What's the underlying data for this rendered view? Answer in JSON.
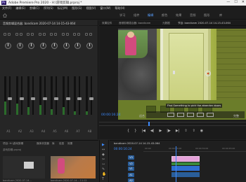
{
  "window": {
    "title": "Adobe Premiere Pro 2020 - H:\\游戏剪辑.prproj *",
    "app_icon": "Pr",
    "controls": [
      "—",
      "☐",
      "✕"
    ]
  },
  "menu": [
    "文件(F)",
    "编辑(E)",
    "剪辑(C)",
    "序列(S)",
    "标记(M)",
    "图形(G)",
    "视图(V)",
    "窗口(W)",
    "帮助(H)"
  ],
  "workspaces": [
    "学习",
    "组件",
    "编辑",
    "颜色",
    "效果",
    "音频",
    "图形",
    "库"
  ],
  "mixer": {
    "title": "音频剪辑混合器: bandicam 2020-07-14 14-15-43-064",
    "channels": [
      "A1",
      "A2",
      "A3",
      "A4",
      "A5",
      "A6",
      "A7",
      "A8"
    ],
    "levels": [
      0.35,
      0.3,
      0.2,
      0.25,
      0.15,
      0.2,
      0.1,
      0.1
    ]
  },
  "monitor": {
    "tabs": [
      "效果控件",
      "音频剪辑混合器: bandicam",
      "元数据",
      "节目: bandicam 2020-07-14 14-15-43-064"
    ],
    "timecode": "00:00:16:24",
    "fit": "适合",
    "quality": "完整",
    "subtitle": "Find Something to pick the abandon doors"
  },
  "project": {
    "tabs": [
      "项目: H:\\游戏剪辑",
      "媒体浏览器",
      "库",
      "信息",
      "效果"
    ],
    "search": "游戏剪辑.prproj",
    "captions": [
      "bandicam 2020-07-14...",
      "bandicam 2020-07-14...  11:12"
    ]
  },
  "tools": [
    "▶",
    "↔",
    "◆",
    "✂",
    "⇿",
    "✎",
    "✋",
    "T"
  ],
  "timeline": {
    "sequence": "bandicam 2020-07-14 14-15-43-064",
    "timecode": "00:00:16:24",
    "ruler": [
      "00:00",
      "00:00:15:00",
      "00:00:30:00",
      "00:00:45:00"
    ],
    "tracks": [
      "V3",
      "V2",
      "V1",
      "A1",
      "A2"
    ]
  }
}
